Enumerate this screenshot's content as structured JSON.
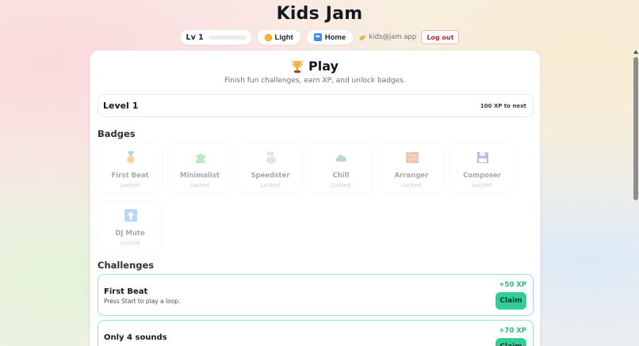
{
  "app": {
    "title": "Kids Jam"
  },
  "topbar": {
    "level_label": "Lv 1",
    "level_progress": 0,
    "theme_label": "Light",
    "home_label": "Home",
    "user_email": "kids@jam.app",
    "logout_label": "Log out",
    "icons": [
      "sun-icon",
      "home-icon",
      "hand-icon"
    ]
  },
  "play": {
    "title": "Play",
    "subtitle": "Finish fun challenges, earn XP, and unlock badges.",
    "level": {
      "name": "Level 1",
      "xp_to_next": "100 XP to next"
    }
  },
  "badges": {
    "title": "Badges",
    "items": [
      {
        "name": "First Beat",
        "status": "Locked",
        "icon": "medal-icon"
      },
      {
        "name": "Minimalist",
        "status": "Locked",
        "icon": "puzzle-icon"
      },
      {
        "name": "Speedster",
        "status": "Locked",
        "icon": "rabbit-icon"
      },
      {
        "name": "Chill",
        "status": "Locked",
        "icon": "cloud-icon"
      },
      {
        "name": "Arranger",
        "status": "Locked",
        "icon": "bricks-icon"
      },
      {
        "name": "Composer",
        "status": "Locked",
        "icon": "floppy-icon"
      },
      {
        "name": "DJ Mute",
        "status": "Locked",
        "icon": "up-arrow-icon"
      }
    ]
  },
  "challenges": {
    "title": "Challenges",
    "items": [
      {
        "title": "First Beat",
        "description": "Press Start to play a loop.",
        "xp": "+50 XP",
        "action": "Claim"
      },
      {
        "title": "Only 4 sounds",
        "description": "",
        "xp": "+70 XP",
        "action": "Claim"
      }
    ]
  },
  "colors": {
    "accent": "#2fcf95",
    "accent_text": "#29b884",
    "challenge_border": "#9fe3c6",
    "logout_red": "#c0262c"
  }
}
